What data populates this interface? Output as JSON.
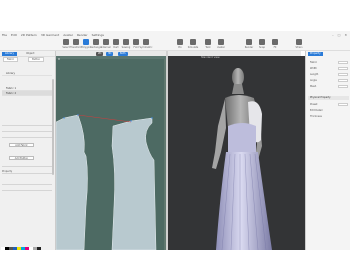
{
  "menubar": {
    "items": [
      "File",
      "Edit",
      "2D Pattern",
      "3D Garment",
      "Avatar",
      "Render",
      "Settings"
    ],
    "right_items": [
      "",
      "",
      ""
    ]
  },
  "toolbar": {
    "left": [
      {
        "label": "Select",
        "icon": "select-icon"
      },
      {
        "label": "Transform",
        "icon": "transform-icon"
      },
      {
        "label": "Polygon",
        "icon": "polygon-icon",
        "selected": true
      },
      {
        "label": "Rectangle",
        "icon": "rectangle-icon"
      },
      {
        "label": "Internal",
        "icon": "internal-line-icon"
      },
      {
        "label": "Dart",
        "icon": "dart-icon"
      },
      {
        "label": "Sewing",
        "icon": "sewing-icon"
      },
      {
        "label": "Fold",
        "icon": "fold-icon"
      },
      {
        "label": "Symmetric",
        "icon": "symmetric-icon"
      },
      {
        "label": "Trace",
        "icon": "trace-icon"
      },
      {
        "label": "Arrange",
        "icon": "arrange-icon"
      }
    ],
    "mid": [
      {
        "label": "Pin",
        "icon": "pin-icon"
      },
      {
        "label": "Simulate",
        "icon": "simulate-icon"
      },
      {
        "label": "Tack",
        "icon": "tack-icon"
      },
      {
        "label": "Avatar",
        "icon": "avatar-icon"
      }
    ],
    "right": [
      {
        "label": "Render",
        "icon": "render-icon"
      },
      {
        "label": "Snap",
        "icon": "snapshot-icon"
      },
      {
        "label": "Fit",
        "icon": "fit-map-icon"
      },
      {
        "label": "Strain",
        "icon": "strain-map-icon"
      }
    ]
  },
  "viewtabs": {
    "a": "2D",
    "b": "3D",
    "c": "Both",
    "caption": "Standard view"
  },
  "left_panel": {
    "tab_active": "Library",
    "tab_other": "Object",
    "sub_tabs": [
      "Fabric",
      "Button"
    ],
    "rows": [
      "Library",
      "Fabric 1",
      "Fabric 2"
    ],
    "buttons": [
      "Add Fabric",
      "Add Button"
    ],
    "section": "Property",
    "swatch_colors": [
      "#ffffff",
      "#000000",
      "#555555",
      "#1f5fb8",
      "#f2e600",
      "#00a6e0",
      "#e0007a",
      "#ffffff",
      "#aaaaaa",
      "#222222"
    ]
  },
  "right_panel": {
    "tab": "Property",
    "rows": [
      "Fabric",
      "Width",
      "Length",
      "Angle",
      "Mesh"
    ],
    "section": "Physical Property",
    "rows2": [
      "Preset",
      "Edit Detail",
      "Thickness"
    ]
  },
  "colors": {
    "accent": "#2a7bd8",
    "canvas_2d": "#4d6a63",
    "canvas_3d": "#333436",
    "pattern_fill": "#b8c9cf",
    "dress": "#c7c7e6"
  }
}
